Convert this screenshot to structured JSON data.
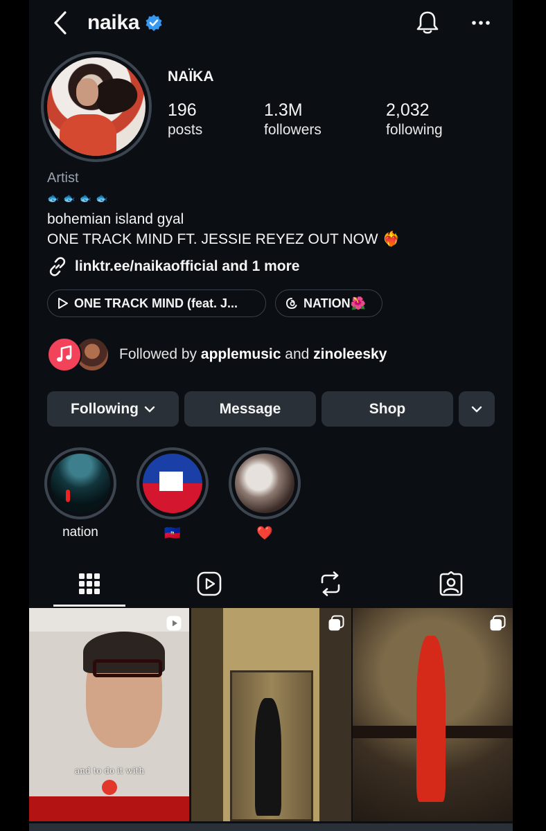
{
  "header": {
    "username": "naika",
    "verified": true
  },
  "profile": {
    "display_name": "NAÏKA",
    "stats": [
      {
        "value": "196",
        "label": "posts"
      },
      {
        "value": "1.3M",
        "label": "followers"
      },
      {
        "value": "2,032",
        "label": "following"
      }
    ],
    "category": "Artist",
    "fish_line": "🐟🐟🐟🐟",
    "bio_line1": "bohemian island gyal",
    "bio_line2": "ONE TRACK MIND FT. JESSIE REYEZ OUT NOW ❤️‍🔥",
    "link": "linktr.ee/naikaofficial and 1 more"
  },
  "chips": [
    {
      "icon": "play-icon",
      "label": "ONE TRACK MIND (feat. J..."
    },
    {
      "icon": "threads-icon",
      "label": "NATION🌺"
    }
  ],
  "followed_by": {
    "prefix": "Followed by ",
    "user1": "applemusic",
    "middle": " and ",
    "user2": "zinoleesky"
  },
  "actions": {
    "following": "Following",
    "message": "Message",
    "shop": "Shop"
  },
  "highlights": [
    {
      "label": "nation"
    },
    {
      "label": "🇭🇹"
    },
    {
      "label": "❤️"
    }
  ],
  "tabs": [
    {
      "icon": "grid-icon",
      "active": true
    },
    {
      "icon": "reels-icon",
      "active": false
    },
    {
      "icon": "reposts-icon",
      "active": false
    },
    {
      "icon": "tagged-icon",
      "active": false
    }
  ],
  "posts": [
    {
      "caption": "and to do it with",
      "type": "reel"
    },
    {
      "caption": "",
      "type": "carousel"
    },
    {
      "caption": "",
      "type": "carousel"
    }
  ],
  "colors": {
    "background": "#0b0f14",
    "button": "#2a3038",
    "verified": "#3897f0",
    "applemusic": "#f2435a"
  }
}
